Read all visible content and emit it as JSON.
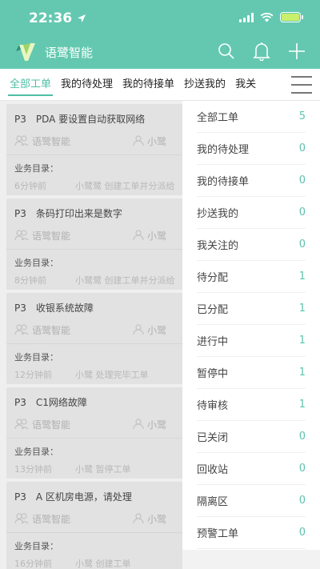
{
  "status_bar": {
    "time": "22:36"
  },
  "header": {
    "brand_name": "语鹭智能"
  },
  "tabs": [
    {
      "label": "全部工单",
      "active": true
    },
    {
      "label": "我的待处理",
      "active": false
    },
    {
      "label": "我的待接单",
      "active": false
    },
    {
      "label": "抄送我的",
      "active": false
    },
    {
      "label": "我关",
      "active": false
    }
  ],
  "cards": [
    {
      "priority": "P3",
      "title": "PDA 要设置自动获取网络",
      "org": "语鹭智能",
      "user": "小鹭",
      "category_label": "业务目录：",
      "ago": "6分钟前",
      "activity": "小鹭鹭 创建工单并分派给"
    },
    {
      "priority": "P3",
      "title": "条码打印出来是数字",
      "org": "语鹭智能",
      "user": "小鹭",
      "category_label": "业务目录：",
      "ago": "8分钟前",
      "activity": "小鹭鹭 创建工单并分派给"
    },
    {
      "priority": "P3",
      "title": "收银系统故障",
      "org": "语鹭智能",
      "user": "小鹭",
      "category_label": "业务目录：",
      "ago": "12分钟前",
      "activity": "小鹭 处理完毕工单"
    },
    {
      "priority": "P3",
      "title": "C1网络故障",
      "org": "语鹭智能",
      "user": "小鹭",
      "category_label": "业务目录：",
      "ago": "13分钟前",
      "activity": "小鹭 暂停工单"
    },
    {
      "priority": "P3",
      "title": "A 区机房电源，请处理",
      "org": "语鹭智能",
      "user": "小鹭",
      "category_label": "业务目录：",
      "ago": "16分钟前",
      "activity": "小鹭 创建工单"
    }
  ],
  "filter_panel": [
    {
      "label": "全部工单",
      "count": "5"
    },
    {
      "label": "我的待处理",
      "count": "0"
    },
    {
      "label": "我的待接单",
      "count": "0"
    },
    {
      "label": "抄送我的",
      "count": "0"
    },
    {
      "label": "我关注的",
      "count": "0"
    },
    {
      "label": "待分配",
      "count": "1"
    },
    {
      "label": "已分配",
      "count": "1"
    },
    {
      "label": "进行中",
      "count": "1"
    },
    {
      "label": "暂停中",
      "count": "1"
    },
    {
      "label": "待审核",
      "count": "1"
    },
    {
      "label": "已关闭",
      "count": "0"
    },
    {
      "label": "回收站",
      "count": "0"
    },
    {
      "label": "隔离区",
      "count": "0"
    },
    {
      "label": "预警工单",
      "count": "0"
    }
  ],
  "colors": {
    "accent": "#64c8b0",
    "count": "#5cc4ac"
  }
}
